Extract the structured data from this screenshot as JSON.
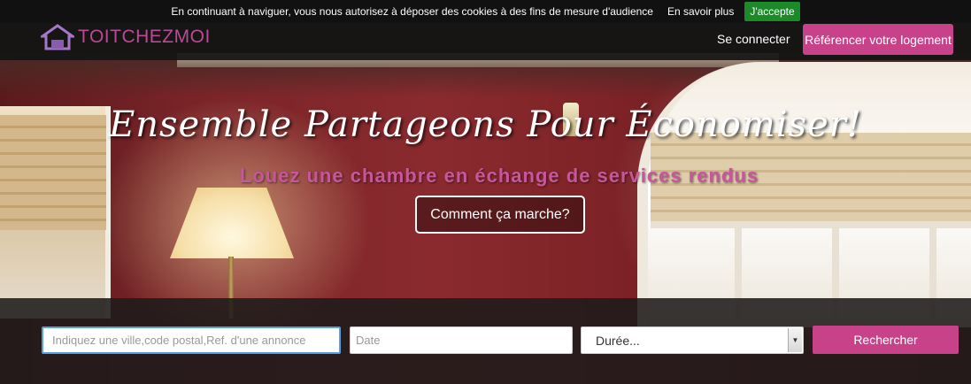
{
  "cookie_bar": {
    "text": "En continuant à naviguer, vous nous autorisez à déposer des cookies à des fins de mesure d'audience",
    "more_label": "En savoir plus",
    "accept_label": "J'accepte"
  },
  "header": {
    "logo_text": "TOITCHEZMOI",
    "login_label": "Se connecter",
    "list_label": "Référencer votre logement"
  },
  "hero": {
    "headline": "Ensemble Partageons Pour Économiser!",
    "subheadline": "Louez une chambre en échange de services rendus",
    "how_label": "Comment ça marche?"
  },
  "search": {
    "location_placeholder": "Indiquez une ville,code postal,Ref. d'une annonce",
    "date_placeholder": "Date",
    "duration_value": "Durée...",
    "submit_label": "Rechercher"
  },
  "colors": {
    "brand_pink": "#c8428a",
    "accept_green": "#1d8a2a",
    "focus_blue": "#5aa0e0"
  }
}
